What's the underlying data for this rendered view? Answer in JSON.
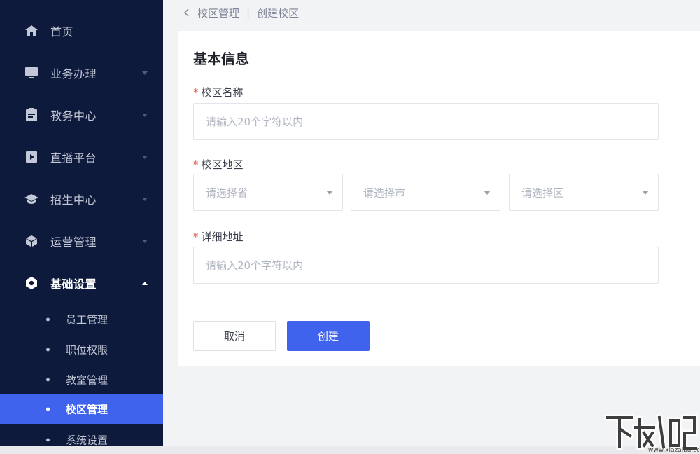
{
  "sidebar": {
    "items": [
      {
        "label": "首页",
        "icon": "home-icon"
      },
      {
        "label": "业务办理",
        "icon": "monitor-icon"
      },
      {
        "label": "教务中心",
        "icon": "clipboard-icon"
      },
      {
        "label": "直播平台",
        "icon": "play-icon"
      },
      {
        "label": "招生中心",
        "icon": "graduation-cap-icon"
      },
      {
        "label": "运营管理",
        "icon": "cube-icon"
      },
      {
        "label": "基础设置",
        "icon": "hexagon-settings-icon"
      }
    ],
    "sub_items": [
      {
        "label": "员工管理"
      },
      {
        "label": "职位权限"
      },
      {
        "label": "教室管理"
      },
      {
        "label": "校区管理"
      },
      {
        "label": "系统设置"
      }
    ]
  },
  "breadcrumb": {
    "parent": "校区管理",
    "separator": "|",
    "current": "创建校区"
  },
  "form": {
    "title": "基本信息",
    "required_mark": "*",
    "name_label": "校区名称",
    "name_placeholder": "请输入20个字符以内",
    "region_label": "校区地区",
    "province_placeholder": "请选择省",
    "city_placeholder": "请选择市",
    "district_placeholder": "请选择区",
    "address_label": "详细地址",
    "address_placeholder": "请输入20个字符以内",
    "cancel_label": "取消",
    "create_label": "创建"
  },
  "watermark": {
    "text": "下载吧",
    "url": "www.xiazaiba.com"
  },
  "colors": {
    "sidebar_bg": "#0e1a3b",
    "accent": "#3f63ec",
    "required": "#ec4a3a"
  }
}
